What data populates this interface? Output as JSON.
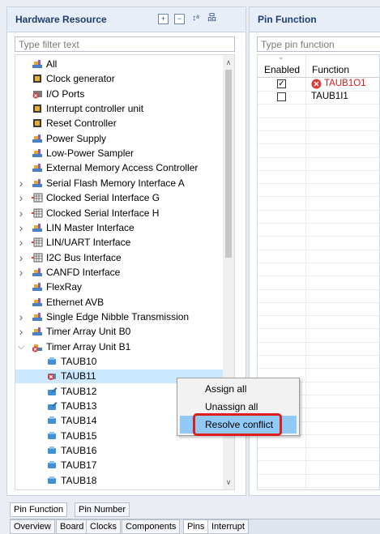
{
  "left_pane": {
    "title": "Hardware Resource",
    "toolbar_icons": [
      "expand-all-icon",
      "collapse-all-icon",
      "sort-az-icon",
      "hierarchy-icon"
    ],
    "filter_placeholder": "Type filter text"
  },
  "tree": {
    "items": [
      {
        "label": "All",
        "icon": "component-icon",
        "expander": ""
      },
      {
        "label": "Clock generator",
        "icon": "chip-icon",
        "expander": ""
      },
      {
        "label": "I/O Ports",
        "icon": "ports-error-icon",
        "expander": ""
      },
      {
        "label": "Interrupt controller unit",
        "icon": "chip-icon",
        "expander": ""
      },
      {
        "label": "Reset Controller",
        "icon": "chip-icon",
        "expander": ""
      },
      {
        "label": "Power Supply",
        "icon": "component-icon",
        "expander": ""
      },
      {
        "label": "Low-Power Sampler",
        "icon": "component-icon",
        "expander": ""
      },
      {
        "label": "External Memory Access Controller",
        "icon": "component-icon",
        "expander": ""
      },
      {
        "label": "Serial Flash Memory Interface A",
        "icon": "component-icon",
        "expander": ">"
      },
      {
        "label": "Clocked Serial Interface G",
        "icon": "grid-module-icon",
        "expander": ">"
      },
      {
        "label": "Clocked Serial Interface H",
        "icon": "grid-module-icon",
        "expander": ">"
      },
      {
        "label": "LIN Master Interface",
        "icon": "component-icon",
        "expander": ">"
      },
      {
        "label": "LIN/UART Interface",
        "icon": "grid-module-icon",
        "expander": ">"
      },
      {
        "label": "I2C Bus Interface",
        "icon": "grid-module-icon",
        "expander": ">"
      },
      {
        "label": "CANFD Interface",
        "icon": "component-icon",
        "expander": ">"
      },
      {
        "label": "FlexRay",
        "icon": "component-icon",
        "expander": ""
      },
      {
        "label": "Ethernet AVB",
        "icon": "component-icon",
        "expander": ""
      },
      {
        "label": "Single Edge Nibble Transmission",
        "icon": "component-icon",
        "expander": ">"
      },
      {
        "label": "Timer Array Unit B0",
        "icon": "component-icon",
        "expander": ">"
      },
      {
        "label": "Timer Array Unit B1",
        "icon": "component-error-icon",
        "expander": "v"
      },
      {
        "label": "TAUB10",
        "icon": "channel-icon",
        "expander": ""
      },
      {
        "label": "TAUB11",
        "icon": "channel-error-icon",
        "expander": ""
      },
      {
        "label": "TAUB12",
        "icon": "channel-edit-icon",
        "expander": ""
      },
      {
        "label": "TAUB13",
        "icon": "channel-edit-icon",
        "expander": ""
      },
      {
        "label": "TAUB14",
        "icon": "channel-icon",
        "expander": ""
      },
      {
        "label": "TAUB15",
        "icon": "channel-icon",
        "expander": ""
      },
      {
        "label": "TAUB16",
        "icon": "channel-icon",
        "expander": ""
      },
      {
        "label": "TAUB17",
        "icon": "channel-icon",
        "expander": ""
      },
      {
        "label": "TAUB18",
        "icon": "channel-icon",
        "expander": ""
      }
    ],
    "selected": "TAUB11"
  },
  "right_pane": {
    "title": "Pin Function",
    "filter_placeholder": "Type pin function",
    "columns": [
      "Enabled",
      "Function"
    ],
    "rows": [
      {
        "enabled": "☑",
        "function": "TAUB1O1",
        "error": true
      },
      {
        "enabled": "☐",
        "function": "TAUB1I1",
        "error": false
      }
    ]
  },
  "context_menu": {
    "items": [
      "Assign all",
      "Unassign all",
      "Resolve conflict"
    ],
    "highlighted": "Resolve conflict"
  },
  "pane_tabs": [
    "Pin Function",
    "Pin Number"
  ],
  "editor_tabs": [
    "Overview",
    "Board",
    "Clocks",
    "Components",
    "Pins",
    "Interrupt"
  ],
  "active_editor_tab": "Pins",
  "colors": {
    "accent": "#1e3d72",
    "selection": "#cce8ff",
    "menu_highlight": "#91c9f7",
    "error": "#e01c1c"
  }
}
